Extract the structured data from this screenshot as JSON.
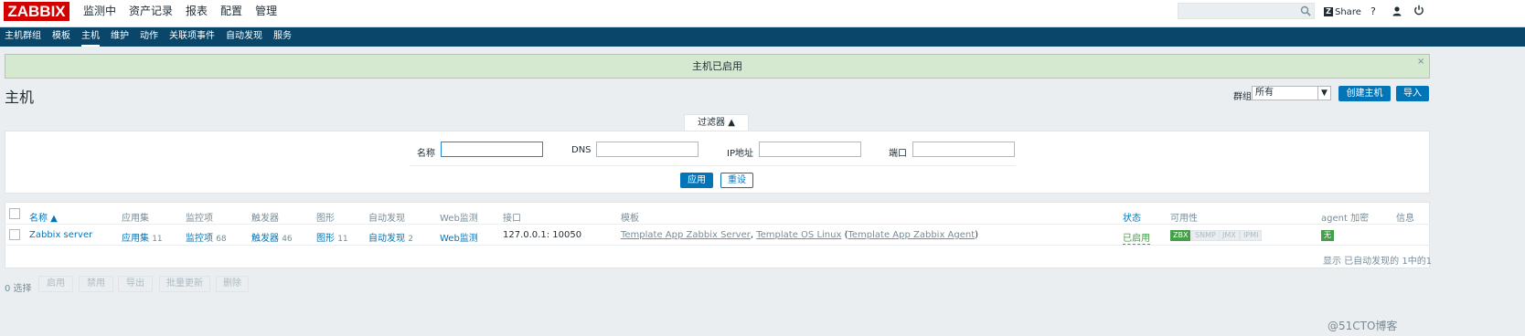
{
  "app": {
    "logo_text": "ZABBIX"
  },
  "topnav": [
    {
      "label": "监测中"
    },
    {
      "label": "资产记录"
    },
    {
      "label": "报表"
    },
    {
      "label": "配置",
      "active": true
    },
    {
      "label": "管理"
    }
  ],
  "header_right": {
    "share_label": "Share",
    "share_badge": "Z",
    "help_label": "?"
  },
  "subnav": [
    {
      "label": "主机群组"
    },
    {
      "label": "模板"
    },
    {
      "label": "主机",
      "active": true
    },
    {
      "label": "维护"
    },
    {
      "label": "动作"
    },
    {
      "label": "关联项事件"
    },
    {
      "label": "自动发现"
    },
    {
      "label": "服务"
    }
  ],
  "message": {
    "text": "主机已启用",
    "close": "×"
  },
  "page": {
    "title": "主机",
    "group_label": "群组",
    "group_value": "所有",
    "create_button": "创建主机",
    "import_button": "导入"
  },
  "filter": {
    "tab_label": "过滤器 ▲",
    "name_label": "名称",
    "dns_label": "DNS",
    "ip_label": "IP地址",
    "port_label": "端口",
    "name_value": "",
    "dns_value": "",
    "ip_value": "",
    "port_value": "",
    "apply_button": "应用",
    "reset_button": "重设"
  },
  "table": {
    "headers": {
      "name": "名称 ▲",
      "apps": "应用集",
      "items": "监控项",
      "triggers": "触发器",
      "graphs": "图形",
      "discovery": "自动发现",
      "web": "Web监测",
      "interface": "接口",
      "templates": "模板",
      "status": "状态",
      "availability": "可用性",
      "agent_encryption": "agent 加密",
      "info": "信息"
    },
    "rows": [
      {
        "name": "Zabbix server",
        "apps": "应用集",
        "apps_count": "11",
        "items": "监控项",
        "items_count": "68",
        "triggers": "触发器",
        "triggers_count": "46",
        "graphs": "图形",
        "graphs_count": "11",
        "discovery": "自动发现",
        "discovery_count": "2",
        "web": "Web监测",
        "interface": "127.0.0.1: 10050",
        "template_1": "Template App Zabbix Server",
        "sep_1": ", ",
        "template_2": "Template OS Linux",
        "paren_open": " (",
        "template_3": "Template App Zabbix Agent",
        "paren_close": ")",
        "status": "已启用",
        "avail": [
          "ZBX",
          "SNMP",
          "JMX",
          "IPMI"
        ],
        "encryption": "无"
      }
    ],
    "footer": "显示 已自动发现的 1中的1"
  },
  "actions": {
    "selected": "0 选择",
    "buttons": [
      "启用",
      "禁用",
      "导出",
      "批量更新",
      "删除"
    ]
  },
  "watermark": "@51CTO博客",
  "colors": {
    "accent": "#0275b8",
    "nav_bg": "#0a466a",
    "logo_red": "#d40000",
    "success_bg": "#d5e8d0"
  }
}
